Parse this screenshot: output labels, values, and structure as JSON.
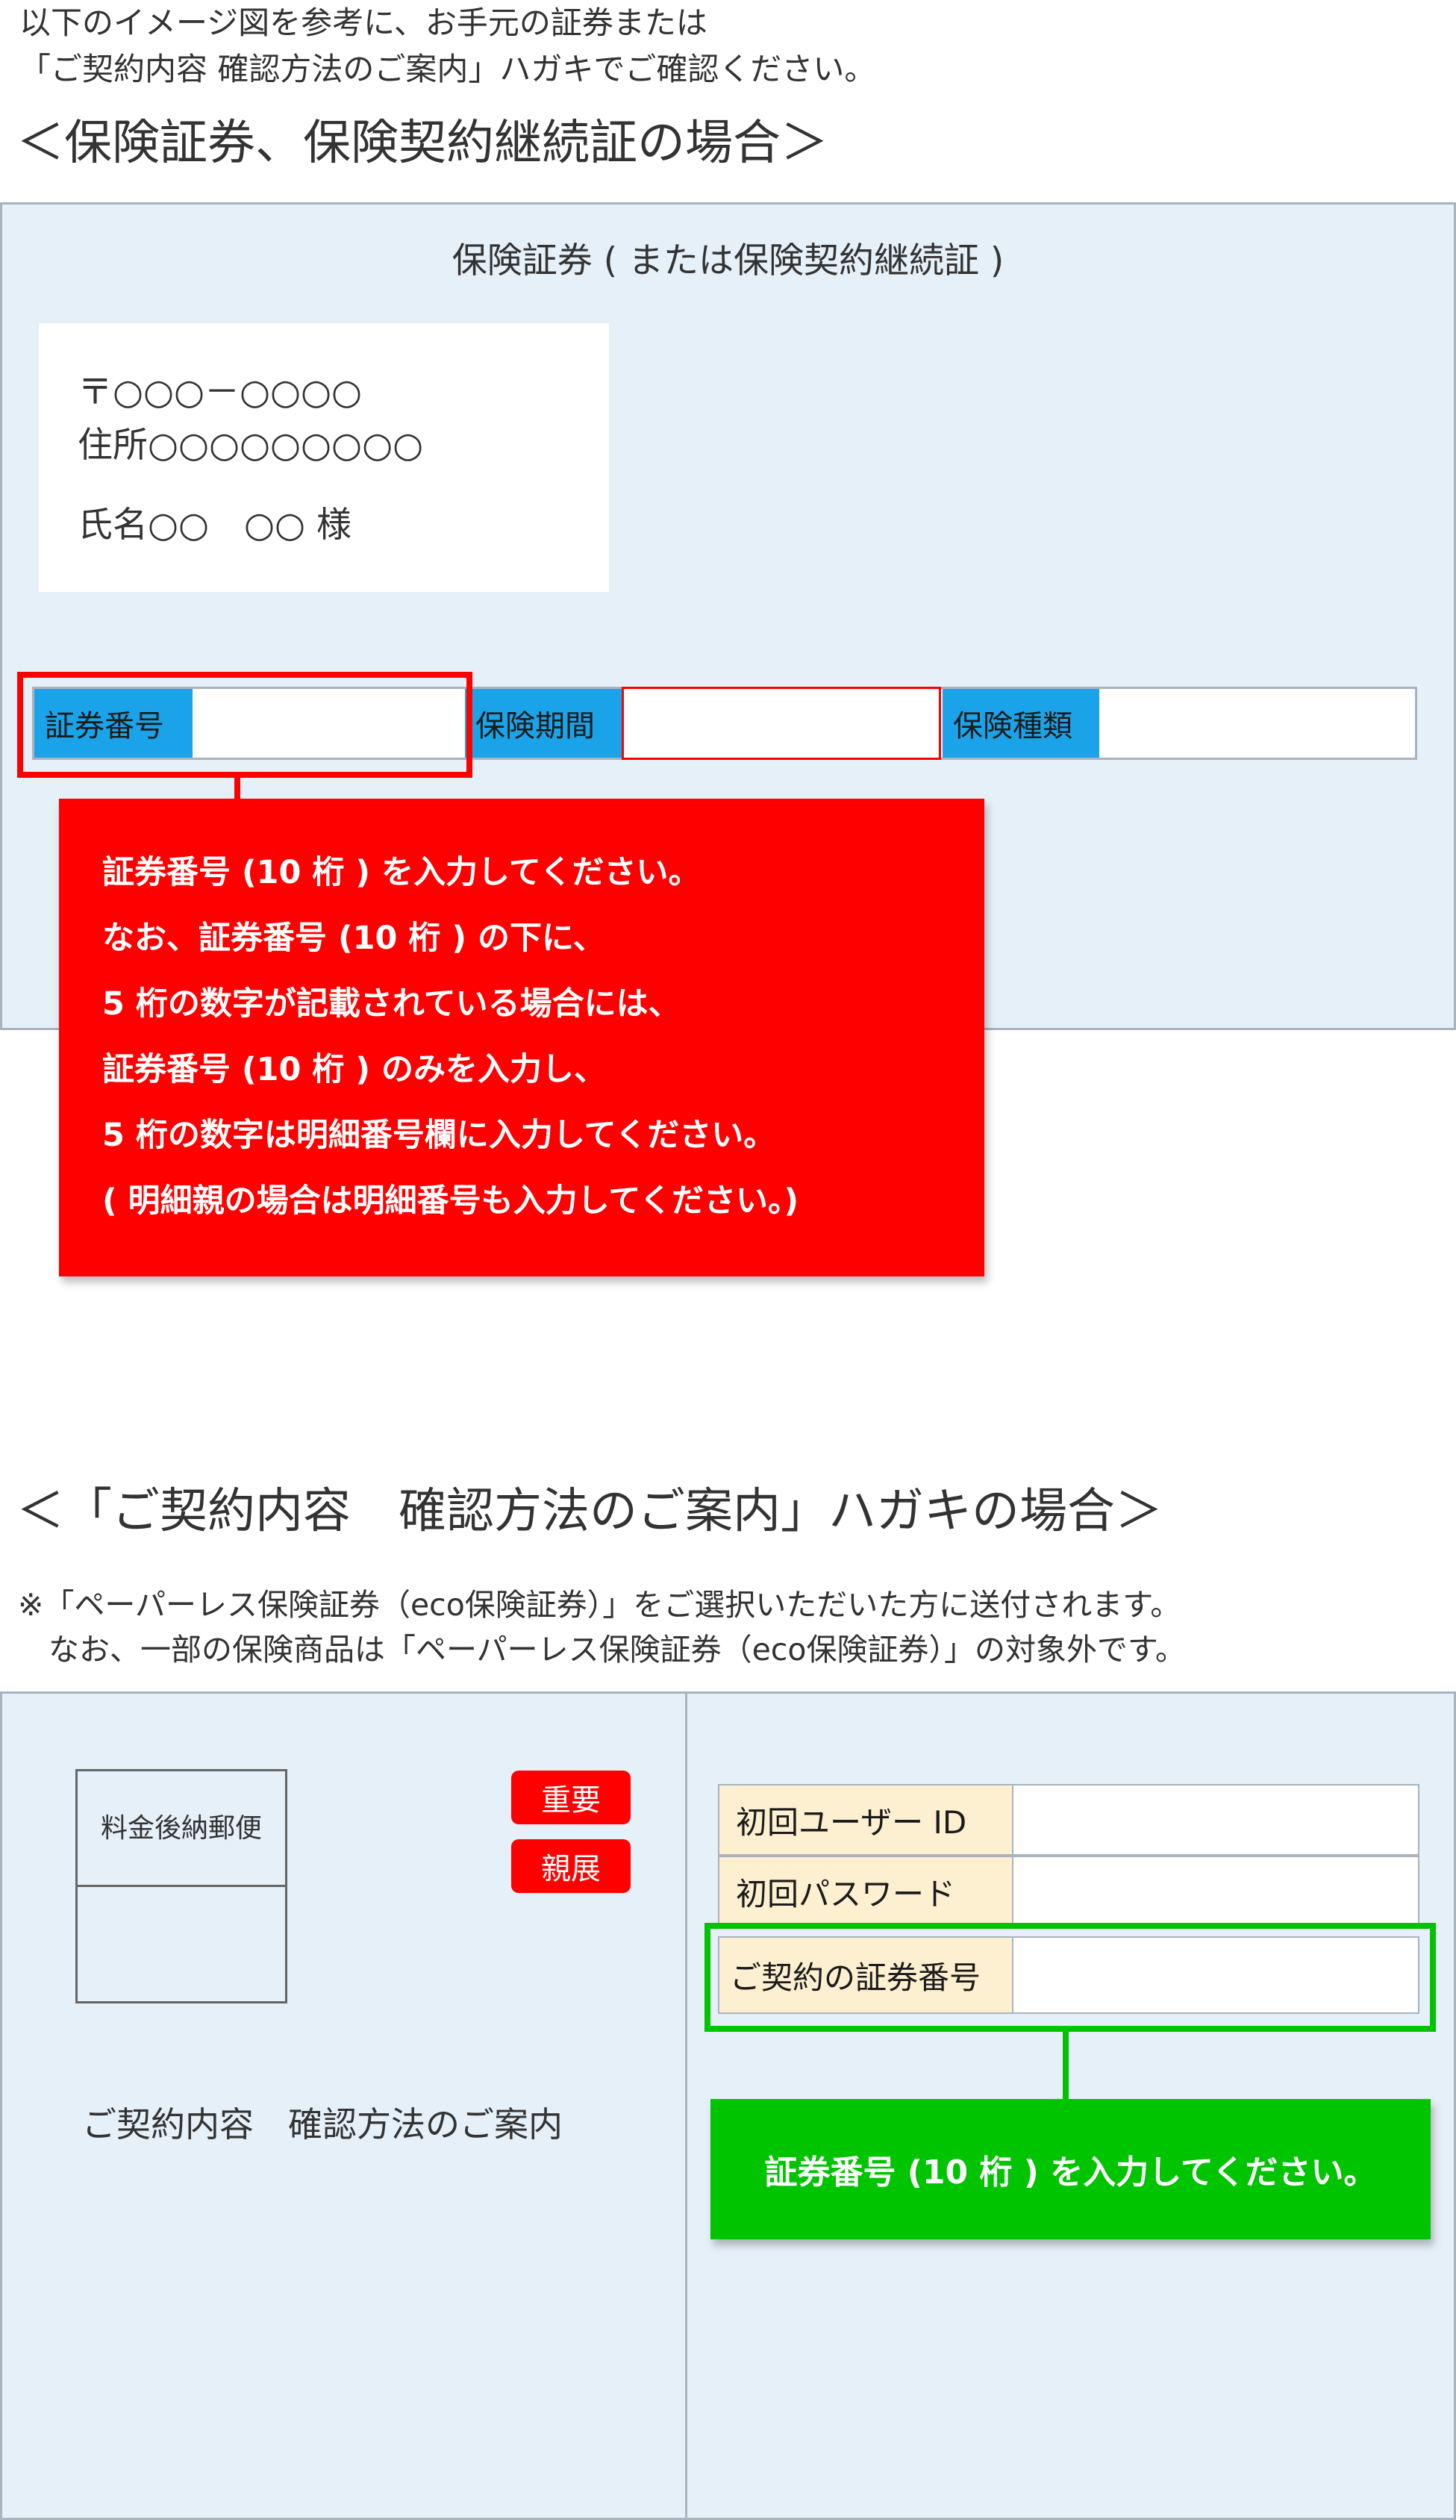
{
  "intro": {
    "line1": "以下のイメージ図を参考に、お手元の証券または",
    "line2": "「ご契約内容  確認方法のご案内」ハガキでご確認ください。"
  },
  "section1": {
    "heading": "＜保険証券、保険契約継続証の場合＞",
    "doc_title": "保険証券 ( または保険契約継続証 )",
    "address": {
      "postal": "〒○○○－○○○○",
      "address": "住所○○○○○○○○○",
      "name": "氏名○○　○○ 様"
    },
    "fields": [
      "証券番号",
      "保険期間",
      "保険種類"
    ],
    "callout_lines": [
      "証券番号 (10 桁 ) を入力してください。",
      "なお、証券番号 (10 桁 ) の下に、",
      "5 桁の数字が記載されている場合には、",
      "証券番号 (10 桁 ) のみを入力し、",
      "5 桁の数字は明細番号欄に入力してください。",
      "( 明細親の場合は明細番号も入力してください。)"
    ]
  },
  "section2": {
    "heading": "＜「ご契約内容　確認方法のご案内」ハガキの場合＞",
    "note_line1": "※「ペーパーレス保険証券（eco保険証券）」をご選択いただいた方に送付されます。",
    "note_line2": "　なお、一部の保険商品は「ペーパーレス保険証券（eco保険証券）」の対象外です。",
    "postage_label": "料金後納郵便",
    "badges": [
      "重要",
      "親展"
    ],
    "card_title": "ご契約内容　確認方法のご案内",
    "grid_labels": [
      "初回ユーザー ID",
      "初回パスワード",
      "ご契約の証券番号"
    ],
    "callout": "証券番号 (10 桁 ) を入力してください。"
  },
  "colors": {
    "panel_bg": "#e6f0f8",
    "field_label_bg": "#1aa3e8",
    "highlight_red": "#ff0000",
    "highlight_green": "#00c400",
    "grid_label_bg": "#fdf0d0"
  }
}
